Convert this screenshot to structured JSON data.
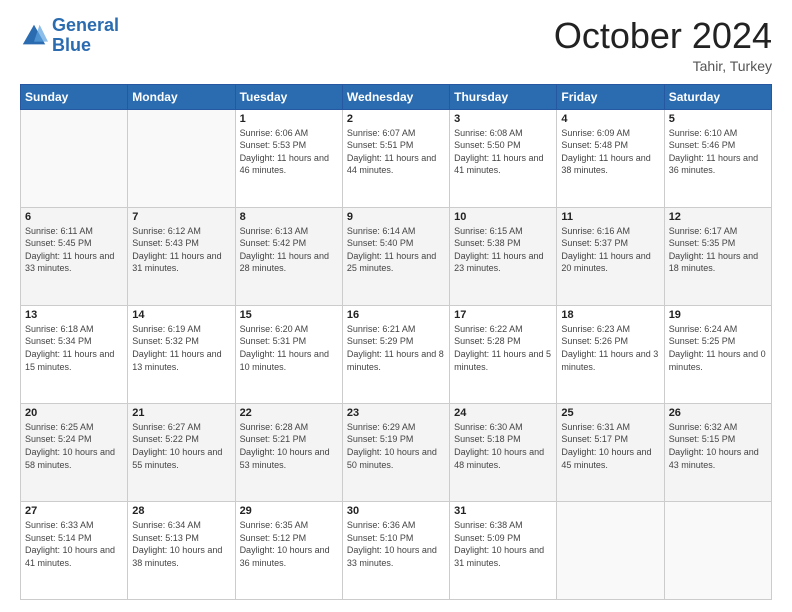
{
  "header": {
    "logo_line1": "General",
    "logo_line2": "Blue",
    "month_title": "October 2024",
    "location": "Tahir, Turkey"
  },
  "days_of_week": [
    "Sunday",
    "Monday",
    "Tuesday",
    "Wednesday",
    "Thursday",
    "Friday",
    "Saturday"
  ],
  "weeks": [
    [
      {
        "day": "",
        "sunrise": "",
        "sunset": "",
        "daylight": ""
      },
      {
        "day": "",
        "sunrise": "",
        "sunset": "",
        "daylight": ""
      },
      {
        "day": "1",
        "sunrise": "Sunrise: 6:06 AM",
        "sunset": "Sunset: 5:53 PM",
        "daylight": "Daylight: 11 hours and 46 minutes."
      },
      {
        "day": "2",
        "sunrise": "Sunrise: 6:07 AM",
        "sunset": "Sunset: 5:51 PM",
        "daylight": "Daylight: 11 hours and 44 minutes."
      },
      {
        "day": "3",
        "sunrise": "Sunrise: 6:08 AM",
        "sunset": "Sunset: 5:50 PM",
        "daylight": "Daylight: 11 hours and 41 minutes."
      },
      {
        "day": "4",
        "sunrise": "Sunrise: 6:09 AM",
        "sunset": "Sunset: 5:48 PM",
        "daylight": "Daylight: 11 hours and 38 minutes."
      },
      {
        "day": "5",
        "sunrise": "Sunrise: 6:10 AM",
        "sunset": "Sunset: 5:46 PM",
        "daylight": "Daylight: 11 hours and 36 minutes."
      }
    ],
    [
      {
        "day": "6",
        "sunrise": "Sunrise: 6:11 AM",
        "sunset": "Sunset: 5:45 PM",
        "daylight": "Daylight: 11 hours and 33 minutes."
      },
      {
        "day": "7",
        "sunrise": "Sunrise: 6:12 AM",
        "sunset": "Sunset: 5:43 PM",
        "daylight": "Daylight: 11 hours and 31 minutes."
      },
      {
        "day": "8",
        "sunrise": "Sunrise: 6:13 AM",
        "sunset": "Sunset: 5:42 PM",
        "daylight": "Daylight: 11 hours and 28 minutes."
      },
      {
        "day": "9",
        "sunrise": "Sunrise: 6:14 AM",
        "sunset": "Sunset: 5:40 PM",
        "daylight": "Daylight: 11 hours and 25 minutes."
      },
      {
        "day": "10",
        "sunrise": "Sunrise: 6:15 AM",
        "sunset": "Sunset: 5:38 PM",
        "daylight": "Daylight: 11 hours and 23 minutes."
      },
      {
        "day": "11",
        "sunrise": "Sunrise: 6:16 AM",
        "sunset": "Sunset: 5:37 PM",
        "daylight": "Daylight: 11 hours and 20 minutes."
      },
      {
        "day": "12",
        "sunrise": "Sunrise: 6:17 AM",
        "sunset": "Sunset: 5:35 PM",
        "daylight": "Daylight: 11 hours and 18 minutes."
      }
    ],
    [
      {
        "day": "13",
        "sunrise": "Sunrise: 6:18 AM",
        "sunset": "Sunset: 5:34 PM",
        "daylight": "Daylight: 11 hours and 15 minutes."
      },
      {
        "day": "14",
        "sunrise": "Sunrise: 6:19 AM",
        "sunset": "Sunset: 5:32 PM",
        "daylight": "Daylight: 11 hours and 13 minutes."
      },
      {
        "day": "15",
        "sunrise": "Sunrise: 6:20 AM",
        "sunset": "Sunset: 5:31 PM",
        "daylight": "Daylight: 11 hours and 10 minutes."
      },
      {
        "day": "16",
        "sunrise": "Sunrise: 6:21 AM",
        "sunset": "Sunset: 5:29 PM",
        "daylight": "Daylight: 11 hours and 8 minutes."
      },
      {
        "day": "17",
        "sunrise": "Sunrise: 6:22 AM",
        "sunset": "Sunset: 5:28 PM",
        "daylight": "Daylight: 11 hours and 5 minutes."
      },
      {
        "day": "18",
        "sunrise": "Sunrise: 6:23 AM",
        "sunset": "Sunset: 5:26 PM",
        "daylight": "Daylight: 11 hours and 3 minutes."
      },
      {
        "day": "19",
        "sunrise": "Sunrise: 6:24 AM",
        "sunset": "Sunset: 5:25 PM",
        "daylight": "Daylight: 11 hours and 0 minutes."
      }
    ],
    [
      {
        "day": "20",
        "sunrise": "Sunrise: 6:25 AM",
        "sunset": "Sunset: 5:24 PM",
        "daylight": "Daylight: 10 hours and 58 minutes."
      },
      {
        "day": "21",
        "sunrise": "Sunrise: 6:27 AM",
        "sunset": "Sunset: 5:22 PM",
        "daylight": "Daylight: 10 hours and 55 minutes."
      },
      {
        "day": "22",
        "sunrise": "Sunrise: 6:28 AM",
        "sunset": "Sunset: 5:21 PM",
        "daylight": "Daylight: 10 hours and 53 minutes."
      },
      {
        "day": "23",
        "sunrise": "Sunrise: 6:29 AM",
        "sunset": "Sunset: 5:19 PM",
        "daylight": "Daylight: 10 hours and 50 minutes."
      },
      {
        "day": "24",
        "sunrise": "Sunrise: 6:30 AM",
        "sunset": "Sunset: 5:18 PM",
        "daylight": "Daylight: 10 hours and 48 minutes."
      },
      {
        "day": "25",
        "sunrise": "Sunrise: 6:31 AM",
        "sunset": "Sunset: 5:17 PM",
        "daylight": "Daylight: 10 hours and 45 minutes."
      },
      {
        "day": "26",
        "sunrise": "Sunrise: 6:32 AM",
        "sunset": "Sunset: 5:15 PM",
        "daylight": "Daylight: 10 hours and 43 minutes."
      }
    ],
    [
      {
        "day": "27",
        "sunrise": "Sunrise: 6:33 AM",
        "sunset": "Sunset: 5:14 PM",
        "daylight": "Daylight: 10 hours and 41 minutes."
      },
      {
        "day": "28",
        "sunrise": "Sunrise: 6:34 AM",
        "sunset": "Sunset: 5:13 PM",
        "daylight": "Daylight: 10 hours and 38 minutes."
      },
      {
        "day": "29",
        "sunrise": "Sunrise: 6:35 AM",
        "sunset": "Sunset: 5:12 PM",
        "daylight": "Daylight: 10 hours and 36 minutes."
      },
      {
        "day": "30",
        "sunrise": "Sunrise: 6:36 AM",
        "sunset": "Sunset: 5:10 PM",
        "daylight": "Daylight: 10 hours and 33 minutes."
      },
      {
        "day": "31",
        "sunrise": "Sunrise: 6:38 AM",
        "sunset": "Sunset: 5:09 PM",
        "daylight": "Daylight: 10 hours and 31 minutes."
      },
      {
        "day": "",
        "sunrise": "",
        "sunset": "",
        "daylight": ""
      },
      {
        "day": "",
        "sunrise": "",
        "sunset": "",
        "daylight": ""
      }
    ]
  ]
}
